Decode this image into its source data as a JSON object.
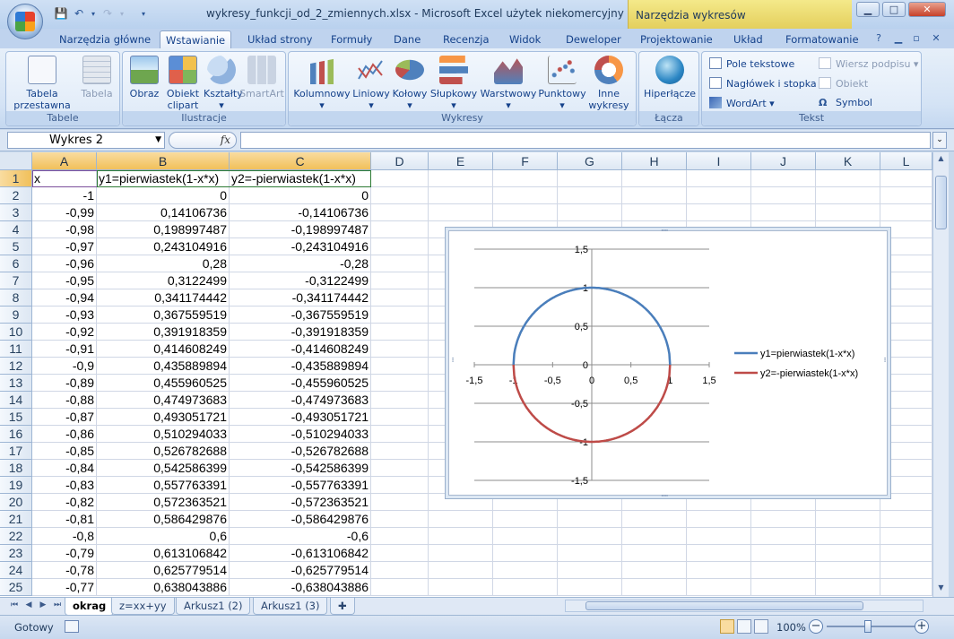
{
  "window": {
    "title": "wykresy_funkcji_od_2_zmiennych.xlsx - Microsoft Excel użytek niekomercyjny",
    "context_title": "Narzędzia wykresów",
    "minimize": "▁",
    "maximize": "□",
    "close": "✕"
  },
  "tabs": [
    "Narzędzia główne",
    "Wstawianie",
    "Układ strony",
    "Formuły",
    "Dane",
    "Recenzja",
    "Widok",
    "Deweloper",
    "Projektowanie",
    "Układ",
    "Formatowanie"
  ],
  "active_tab": "Wstawianie",
  "ribbon": {
    "groups": {
      "tabele": "Tabele",
      "ilustracje": "Ilustracje",
      "wykresy": "Wykresy",
      "lacza": "Łącza",
      "tekst": "Tekst"
    },
    "buttons": {
      "tabela_przestawna": [
        "Tabela",
        "przestawna ▾"
      ],
      "tabela": "Tabela",
      "obraz": "Obraz",
      "obiekt_clipart": [
        "Obiekt",
        "clipart"
      ],
      "ksztalty": [
        "Kształty",
        "▾"
      ],
      "smartart": "SmartArt",
      "kolumnowy": [
        "Kolumnowy",
        "▾"
      ],
      "liniowy": [
        "Liniowy",
        "▾"
      ],
      "kolowy": [
        "Kołowy",
        "▾"
      ],
      "slupkowy": [
        "Słupkowy",
        "▾"
      ],
      "warstwowy": [
        "Warstwowy",
        "▾"
      ],
      "punktowy": [
        "Punktowy",
        "▾"
      ],
      "inne_wykresy": [
        "Inne",
        "wykresy ▾"
      ],
      "hiperlacze": "Hiperłącze",
      "pole_tekstowe": "Pole tekstowe",
      "naglowek_stopka": "Nagłówek i stopka",
      "wordart": "WordArt ▾",
      "wiersz_podpisu": "Wiersz podpisu ▾",
      "obiekt": "Obiekt",
      "symbol": "Symbol"
    }
  },
  "formula_bar": {
    "name_box": "Wykres 2",
    "fx": "fx",
    "value": ""
  },
  "columns": [
    "A",
    "B",
    "C",
    "D",
    "E",
    "F",
    "G",
    "H",
    "I",
    "J",
    "K",
    "L"
  ],
  "rows": [
    [
      "1",
      "x",
      "y1=pierwiastek(1-x*x)",
      "y2=-pierwiastek(1-x*x)"
    ],
    [
      "2",
      "-1",
      "0",
      "0"
    ],
    [
      "3",
      "-0,99",
      "0,14106736",
      "-0,14106736"
    ],
    [
      "4",
      "-0,98",
      "0,198997487",
      "-0,198997487"
    ],
    [
      "5",
      "-0,97",
      "0,243104916",
      "-0,243104916"
    ],
    [
      "6",
      "-0,96",
      "0,28",
      "-0,28"
    ],
    [
      "7",
      "-0,95",
      "0,3122499",
      "-0,3122499"
    ],
    [
      "8",
      "-0,94",
      "0,341174442",
      "-0,341174442"
    ],
    [
      "9",
      "-0,93",
      "0,367559519",
      "-0,367559519"
    ],
    [
      "10",
      "-0,92",
      "0,391918359",
      "-0,391918359"
    ],
    [
      "11",
      "-0,91",
      "0,414608249",
      "-0,414608249"
    ],
    [
      "12",
      "-0,9",
      "0,435889894",
      "-0,435889894"
    ],
    [
      "13",
      "-0,89",
      "0,455960525",
      "-0,455960525"
    ],
    [
      "14",
      "-0,88",
      "0,474973683",
      "-0,474973683"
    ],
    [
      "15",
      "-0,87",
      "0,493051721",
      "-0,493051721"
    ],
    [
      "16",
      "-0,86",
      "0,510294033",
      "-0,510294033"
    ],
    [
      "17",
      "-0,85",
      "0,526782688",
      "-0,526782688"
    ],
    [
      "18",
      "-0,84",
      "0,542586399",
      "-0,542586399"
    ],
    [
      "19",
      "-0,83",
      "0,557763391",
      "-0,557763391"
    ],
    [
      "20",
      "-0,82",
      "0,572363521",
      "-0,572363521"
    ],
    [
      "21",
      "-0,81",
      "0,586429876",
      "-0,586429876"
    ],
    [
      "22",
      "-0,8",
      "0,6",
      "-0,6"
    ],
    [
      "23",
      "-0,79",
      "0,613106842",
      "-0,613106842"
    ],
    [
      "24",
      "-0,78",
      "0,625779514",
      "-0,625779514"
    ],
    [
      "25",
      "-0,77",
      "0,638043886",
      "-0,638043886"
    ]
  ],
  "sheet_tabs": [
    "okrag",
    "z=xx+yy",
    "Arkusz1 (2)",
    "Arkusz1 (3)"
  ],
  "active_sheet": "okrag",
  "status": {
    "text": "Gotowy",
    "zoom": "100%"
  },
  "colors": {
    "series1": "#4a7ebb",
    "series2": "#be4b48"
  },
  "chart_data": {
    "type": "scatter",
    "title": "",
    "xlabel": "",
    "ylabel": "",
    "xlim": [
      -1.5,
      1.5
    ],
    "ylim": [
      -1.5,
      1.5
    ],
    "x_ticks": [
      "-1,5",
      "-1",
      "-0,5",
      "0",
      "0,5",
      "1",
      "1,5"
    ],
    "y_ticks": [
      "1,5",
      "1",
      "0,5",
      "0",
      "-0,5",
      "-1",
      "-1,5"
    ],
    "grid": "horizontal",
    "legend": "right",
    "series": [
      {
        "name": "y1=pierwiastek(1-x*x)",
        "color": "#4a7ebb",
        "formula": "y=sqrt(1-x^2)",
        "x_range": [
          -1,
          1
        ],
        "x_step": 0.01
      },
      {
        "name": "y2=-pierwiastek(1-x*x)",
        "color": "#be4b48",
        "formula": "y=-sqrt(1-x^2)",
        "x_range": [
          -1,
          1
        ],
        "x_step": 0.01
      }
    ]
  }
}
